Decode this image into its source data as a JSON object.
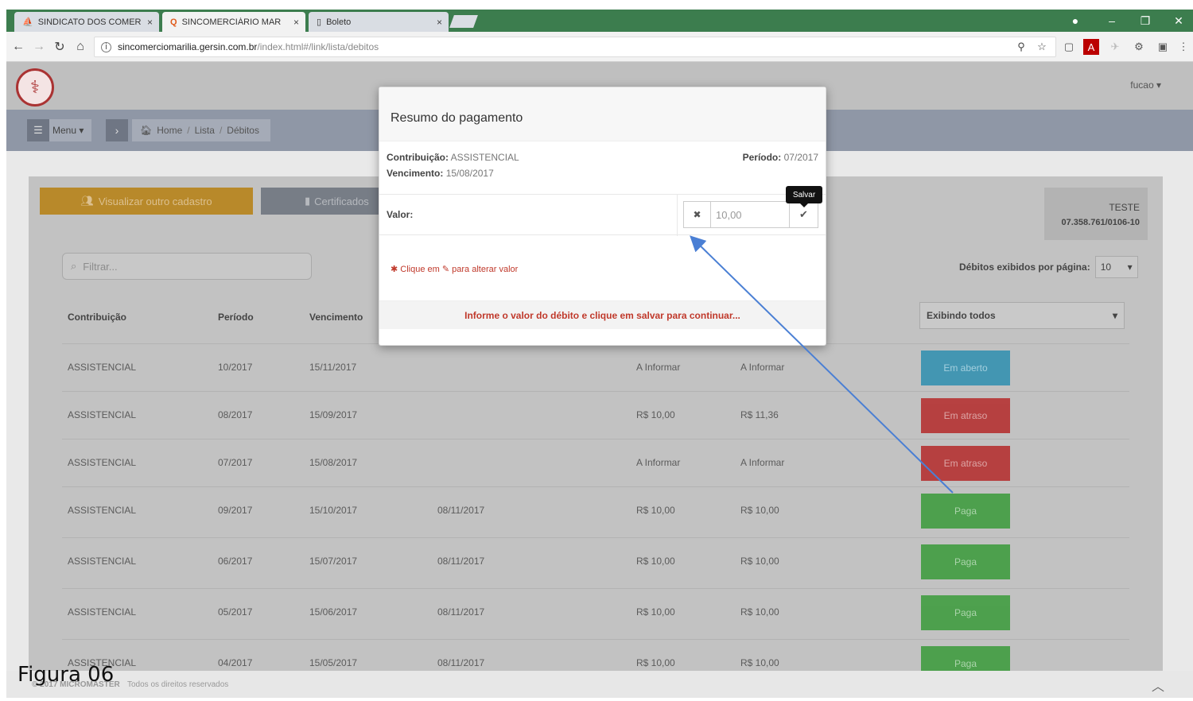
{
  "browser": {
    "tabs": [
      {
        "label": "SINDICATO DOS COMER",
        "icon": "ship-icon"
      },
      {
        "label": "SINCOMERCIÁRIO MAR",
        "icon": "q-favicon-icon"
      },
      {
        "label": "Boleto",
        "icon": "document-icon"
      }
    ],
    "url_host": "sincomerciomarilia.gersin.com.br",
    "url_path": "/index.html#/link/lista/debitos"
  },
  "app": {
    "user": "fucao ▾",
    "menu_label": "Menu ▾",
    "breadcrumb": [
      "Home",
      "Lista",
      "Débitos"
    ]
  },
  "actions": {
    "other_register": "Visualizar outro cadastro",
    "certificates": "Certificados"
  },
  "company": {
    "name": "TESTE",
    "cnpj": "07.358.761/0106-10"
  },
  "filter_placeholder": "Filtrar...",
  "per_page": {
    "label": "Débitos exibidos por página:",
    "value": "10"
  },
  "show_all": "Exibindo todos",
  "table": {
    "headers": [
      "Contribuição",
      "Período",
      "Vencimento"
    ],
    "rows": [
      {
        "contrib": "ASSISTENCIAL",
        "periodo": "10/2017",
        "venc": "15/11/2017",
        "pago_em": "",
        "valor": "A Informar",
        "total": "A Informar",
        "status": "Em aberto",
        "status_type": "blue"
      },
      {
        "contrib": "ASSISTENCIAL",
        "periodo": "08/2017",
        "venc": "15/09/2017",
        "pago_em": "",
        "valor": "R$ 10,00",
        "total": "R$ 11,36",
        "status": "Em atraso",
        "status_type": "red"
      },
      {
        "contrib": "ASSISTENCIAL",
        "periodo": "07/2017",
        "venc": "15/08/2017",
        "pago_em": "",
        "valor": "A Informar",
        "total": "A Informar",
        "status": "Em atraso",
        "status_type": "red"
      },
      {
        "contrib": "ASSISTENCIAL",
        "periodo": "09/2017",
        "venc": "15/10/2017",
        "pago_em": "08/11/2017",
        "valor": "R$ 10,00",
        "total": "R$ 10,00",
        "status": "Paga",
        "status_type": "green"
      },
      {
        "contrib": "ASSISTENCIAL",
        "periodo": "06/2017",
        "venc": "15/07/2017",
        "pago_em": "08/11/2017",
        "valor": "R$ 10,00",
        "total": "R$ 10,00",
        "status": "Paga",
        "status_type": "green"
      },
      {
        "contrib": "ASSISTENCIAL",
        "periodo": "05/2017",
        "venc": "15/06/2017",
        "pago_em": "08/11/2017",
        "valor": "R$ 10,00",
        "total": "R$ 10,00",
        "status": "Paga",
        "status_type": "green"
      },
      {
        "contrib": "ASSISTENCIAL",
        "periodo": "04/2017",
        "venc": "15/05/2017",
        "pago_em": "08/11/2017",
        "valor": "R$ 10,00",
        "total": "R$ 10,00",
        "status": "Paga",
        "status_type": "green"
      }
    ]
  },
  "footer": {
    "copy": "© 2017 MICROMASTER",
    "text": "Todos os direitos reservados"
  },
  "caption": "Figura 06",
  "modal": {
    "title": "Resumo do pagamento",
    "contrib_label": "Contribuição:",
    "contrib_value": "ASSISTENCIAL",
    "venc_label": "Vencimento:",
    "venc_value": "15/08/2017",
    "periodo_label": "Período:",
    "periodo_value": "07/2017",
    "valor_label": "Valor:",
    "valor_value": "10,00",
    "save_tooltip": "Salvar",
    "hint_prefix": "Clique em",
    "hint_suffix": "para alterar valor",
    "footer_msg": "Informe o valor do débito e clique em salvar para continuar..."
  },
  "colors": {
    "blue": "#2e8fb0",
    "red": "#b52a2a",
    "green": "#399b39",
    "orange": "#b8892a",
    "annotation_arrow": "#4a7fd4"
  }
}
